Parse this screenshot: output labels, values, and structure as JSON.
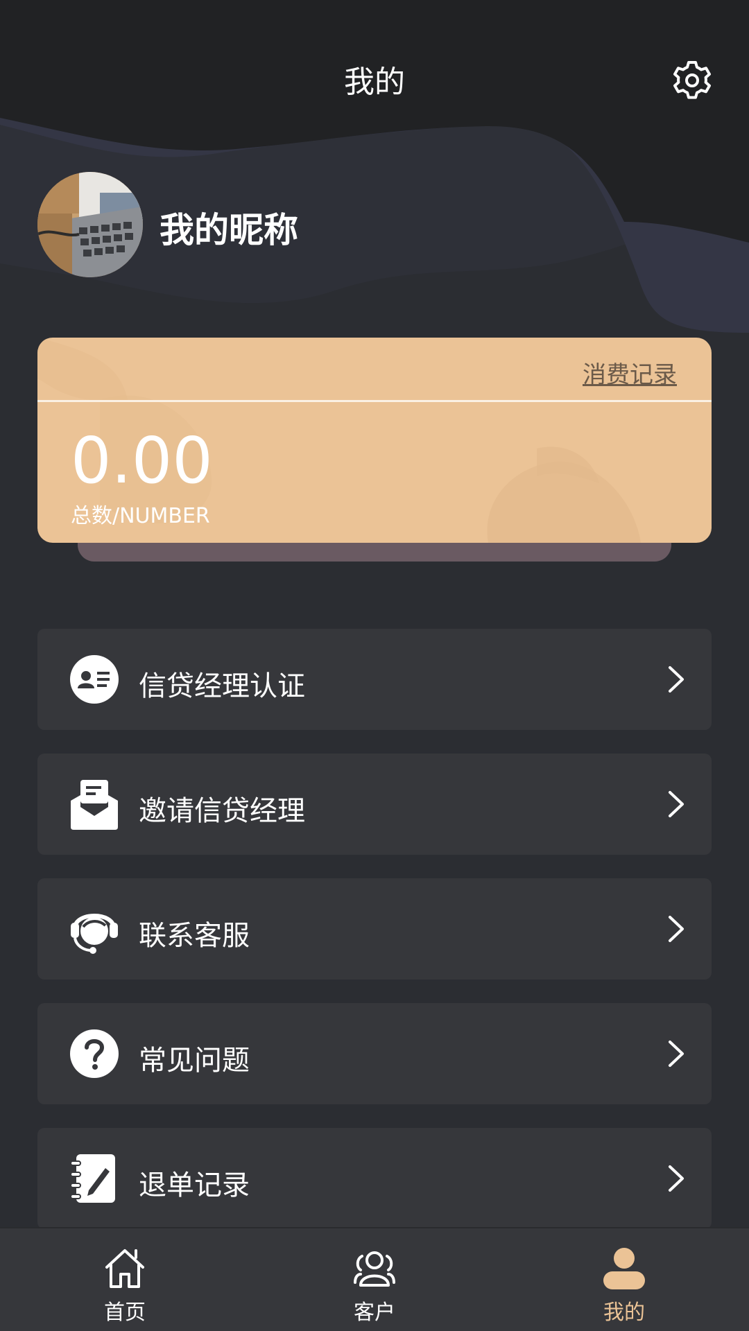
{
  "header": {
    "title": "我的",
    "settings_icon": "gear-icon"
  },
  "profile": {
    "nickname": "我的昵称",
    "avatar_icon": "avatar-laptop-photo"
  },
  "balance_card": {
    "link_label": "消费记录",
    "value": "0.00",
    "caption": "总数/NUMBER",
    "color": "#ebc396"
  },
  "menu": [
    {
      "label": "信贷经理认证",
      "icon": "id-card-icon"
    },
    {
      "label": "邀请信贷经理",
      "icon": "envelope-icon"
    },
    {
      "label": "联系客服",
      "icon": "headset-icon"
    },
    {
      "label": "常见问题",
      "icon": "question-icon"
    },
    {
      "label": "退单记录",
      "icon": "notebook-pen-icon"
    }
  ],
  "tab_bar": {
    "active_color": "#ebc396",
    "tabs": [
      {
        "label": "首页",
        "icon": "home-icon",
        "active": false
      },
      {
        "label": "客户",
        "icon": "users-icon",
        "active": false
      },
      {
        "label": "我的",
        "icon": "person-icon",
        "active": true
      }
    ]
  }
}
